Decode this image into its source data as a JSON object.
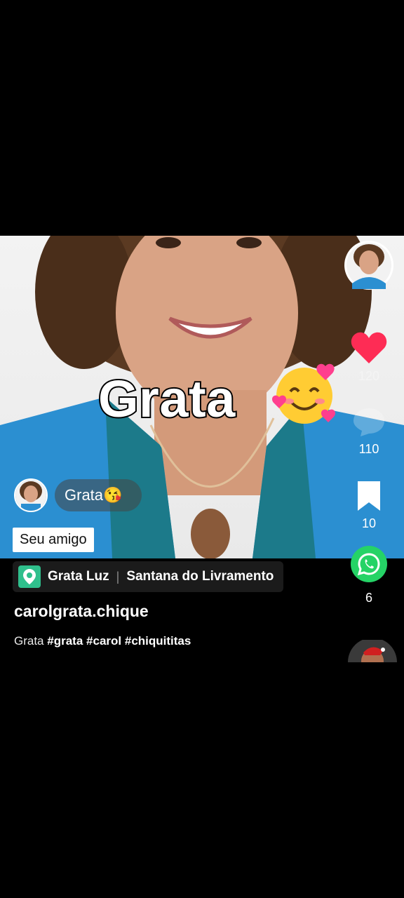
{
  "video": {
    "overlay_text": "Grata"
  },
  "comment": {
    "text": "Grata😘",
    "badge": "Seu amigo"
  },
  "right_rail": {
    "like_count": "120",
    "comment_count": "110",
    "bookmark_count": "10",
    "share_count": "6"
  },
  "location": {
    "place": "Grata Luz",
    "city": "Santana do Livramento"
  },
  "post": {
    "username": "carolgrata.chique",
    "caption_prefix": "Grata",
    "hashtags": [
      "#grata",
      "#carol",
      "#chiquititas"
    ]
  },
  "colors": {
    "like": "#fe2c55",
    "whatsapp": "#25d366",
    "location": "#2fbf8c"
  },
  "icons": {
    "like": "heart-icon",
    "comment": "comment-icon",
    "bookmark": "bookmark-icon",
    "share": "whatsapp-icon",
    "location": "location-pin-icon"
  }
}
